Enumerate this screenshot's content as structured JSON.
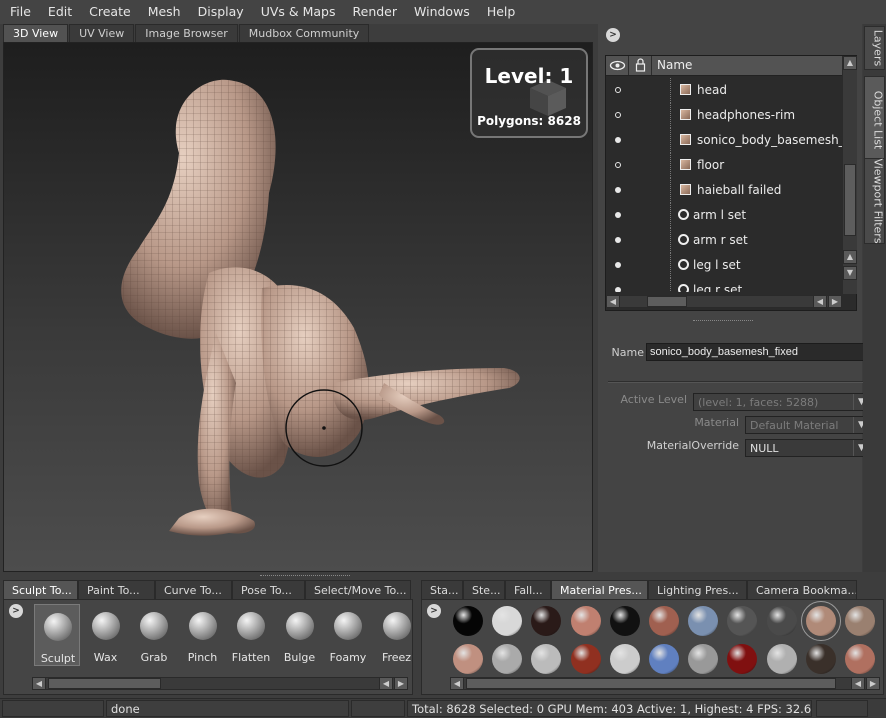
{
  "menubar": {
    "items": [
      "File",
      "Edit",
      "Create",
      "Mesh",
      "Display",
      "UVs & Maps",
      "Render",
      "Windows",
      "Help"
    ]
  },
  "view_tabs": [
    "3D View",
    "UV View",
    "Image Browser",
    "Mudbox Community"
  ],
  "viewport": {
    "level_text": "Level: 1",
    "polygons_text": "Polygons: 8628"
  },
  "side_tabs": [
    "Layers",
    "Object List",
    "Viewport Filters"
  ],
  "outliner": {
    "name_header": "Name",
    "rows": [
      {
        "label": "head",
        "kind": "mesh",
        "visible": "hollow"
      },
      {
        "label": "headphones-rim",
        "kind": "mesh",
        "visible": "hollow"
      },
      {
        "label": "sonico_body_basemesh_fixed",
        "kind": "mesh",
        "visible": "filled"
      },
      {
        "label": "floor",
        "kind": "mesh",
        "visible": "hollow"
      },
      {
        "label": "haieball failed",
        "kind": "mesh",
        "visible": "filled"
      },
      {
        "label": "arm l set",
        "kind": "set",
        "visible": "filled"
      },
      {
        "label": "arm r set",
        "kind": "set",
        "visible": "filled"
      },
      {
        "label": "leg l set",
        "kind": "set",
        "visible": "filled"
      },
      {
        "label": "leg r set",
        "kind": "set",
        "visible": "filled"
      }
    ]
  },
  "properties": {
    "name_label": "Name",
    "name_value": "sonico_body_basemesh_fixed",
    "active_level_label": "Active Level",
    "active_level_value": "(level: 1, faces: 5288)",
    "material_label": "Material",
    "material_value": "Default Material",
    "material_override_label": "MaterialOverride",
    "material_override_value": "NULL"
  },
  "tray_left": {
    "tabs": [
      "Sculpt To...",
      "Paint To...",
      "Curve To...",
      "Pose To...",
      "Select/Move To..."
    ],
    "active_tab": "Sculpt To...",
    "tools": [
      "Sculpt",
      "Wax",
      "Grab",
      "Pinch",
      "Flatten",
      "Bulge",
      "Foamy",
      "Freez"
    ]
  },
  "tray_right": {
    "tabs": [
      "Sta...",
      "Ste...",
      "Fall...",
      "Material Pres...",
      "Lighting Pres...",
      "Camera Bookma..."
    ],
    "active_tab": "Material Pres...",
    "materials_row1": [
      "#050505",
      "#d8d8d8",
      "#2a1a18",
      "#c08070",
      "#111111",
      "#a06050",
      "#7a90b0",
      "#555555",
      "#4a4a4a",
      "#b08a78",
      "#9a8070"
    ],
    "materials_row2": [
      "#c09080",
      "#aaaaaa",
      "#bbbbbb",
      "#903020",
      "#cccccc",
      "#6080c0",
      "#999999",
      "#801010",
      "#b0b0b0",
      "#3a302a",
      "#b07060"
    ]
  },
  "status": {
    "message": "done",
    "stats": "Total: 8628  Selected: 0 GPU Mem: 403  Active: 1, Highest: 4  FPS: 32.6832"
  }
}
